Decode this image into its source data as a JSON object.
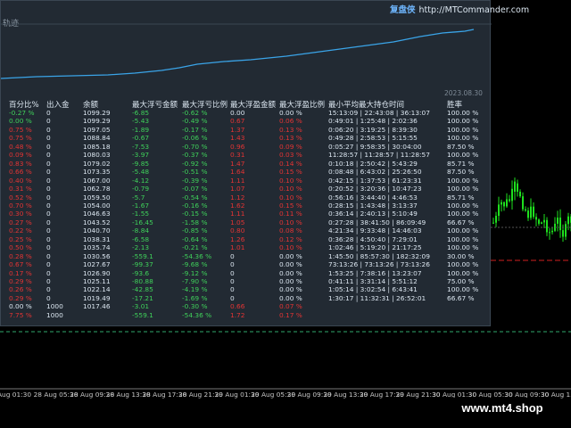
{
  "panel": {
    "title_cn": "复盘侠",
    "title_url": "http://MTCommander.com",
    "curve_label": "轨迹",
    "curve_date": "2023.08.30"
  },
  "colors": {
    "positive": "#3fd05a",
    "negative": "#e23434",
    "neutral": "#dbe6f0",
    "curve": "#3aa4e8"
  },
  "columns": [
    "百分比%",
    "出入金",
    "余额",
    "最大浮亏金额",
    "最大浮亏比例",
    "最大浮盈金额",
    "最大浮盈比例",
    "最小平均最大持仓时间",
    "胜率"
  ],
  "rows": [
    {
      "pct": "-0.27 %",
      "pc": "green",
      "io": "0",
      "bal": "1099.29",
      "fl": "-6.85",
      "flp": "-0.62 %",
      "fp": "0.00",
      "fpc": "white",
      "fpp": "0.00 %",
      "fppc": "white",
      "time": "15:13:09 | 22:43:08 | 36:13:07",
      "win": "100.00 %"
    },
    {
      "pct": "0.00 %",
      "pc": "green",
      "io": "0",
      "bal": "1099.29",
      "fl": "-5.43",
      "flp": "-0.49 %",
      "fp": "0.67",
      "fpc": "red",
      "fpp": "0.06 %",
      "fppc": "red",
      "time": "0:49:01 | 1:25:48 | 2:02:36",
      "win": "100.00 %"
    },
    {
      "pct": "0.75 %",
      "pc": "red",
      "io": "0",
      "bal": "1097.05",
      "fl": "-1.89",
      "flp": "-0.17 %",
      "fp": "1.37",
      "fpc": "red",
      "fpp": "0.13 %",
      "fppc": "red",
      "time": "0:06:20 | 3:19:25 | 8:39:30",
      "win": "100.00 %"
    },
    {
      "pct": "0.75 %",
      "pc": "red",
      "io": "0",
      "bal": "1088.84",
      "fl": "-0.67",
      "flp": "-0.06 %",
      "fp": "1.43",
      "fpc": "red",
      "fpp": "0.13 %",
      "fppc": "red",
      "time": "0:49:28 | 2:58:53 | 5:15:55",
      "win": "100.00 %"
    },
    {
      "pct": "0.48 %",
      "pc": "red",
      "io": "0",
      "bal": "1085.18",
      "fl": "-7.53",
      "flp": "-0.70 %",
      "fp": "0.96",
      "fpc": "red",
      "fpp": "0.09 %",
      "fppc": "red",
      "time": "0:05:27 | 9:58:35 | 30:04:00",
      "win": "87.50 %"
    },
    {
      "pct": "0.09 %",
      "pc": "red",
      "io": "0",
      "bal": "1080.03",
      "fl": "-3.97",
      "flp": "-0.37 %",
      "fp": "0.31",
      "fpc": "red",
      "fpp": "0.03 %",
      "fppc": "red",
      "time": "11:28:57 | 11:28:57 | 11:28:57",
      "win": "100.00 %"
    },
    {
      "pct": "0.83 %",
      "pc": "red",
      "io": "0",
      "bal": "1079.02",
      "fl": "-9.85",
      "flp": "-0.92 %",
      "fp": "1.47",
      "fpc": "red",
      "fpp": "0.14 %",
      "fppc": "red",
      "time": "0:10:18 | 2:50:42 | 5:43:29",
      "win": "85.71 %"
    },
    {
      "pct": "0.66 %",
      "pc": "red",
      "io": "0",
      "bal": "1073.35",
      "fl": "-5.48",
      "flp": "-0.51 %",
      "fp": "1.64",
      "fpc": "red",
      "fpp": "0.15 %",
      "fppc": "red",
      "time": "0:08:48 | 6:43:02 | 25:26:50",
      "win": "87.50 %"
    },
    {
      "pct": "0.40 %",
      "pc": "red",
      "io": "0",
      "bal": "1067.00",
      "fl": "-4.12",
      "flp": "-0.39 %",
      "fp": "1.11",
      "fpc": "red",
      "fpp": "0.10 %",
      "fppc": "red",
      "time": "0:42:15 | 1:37:53 | 61:23:31",
      "win": "100.00 %"
    },
    {
      "pct": "0.31 %",
      "pc": "red",
      "io": "0",
      "bal": "1062.78",
      "fl": "-0.79",
      "flp": "-0.07 %",
      "fp": "1.07",
      "fpc": "red",
      "fpp": "0.10 %",
      "fppc": "red",
      "time": "0:20:52 | 3:20:36 | 10:47:23",
      "win": "100.00 %"
    },
    {
      "pct": "0.52 %",
      "pc": "red",
      "io": "0",
      "bal": "1059.50",
      "fl": "-5.7",
      "flp": "-0.54 %",
      "fp": "1.12",
      "fpc": "red",
      "fpp": "0.10 %",
      "fppc": "red",
      "time": "0:56:16 | 3:44:40 | 4:46:53",
      "win": "85.71 %"
    },
    {
      "pct": "0.70 %",
      "pc": "red",
      "io": "0",
      "bal": "1054.00",
      "fl": "-1.67",
      "flp": "-0.16 %",
      "fp": "1.62",
      "fpc": "red",
      "fpp": "0.15 %",
      "fppc": "red",
      "time": "0:28:15 | 1:43:48 | 3:13:37",
      "win": "100.00 %"
    },
    {
      "pct": "0.30 %",
      "pc": "red",
      "io": "0",
      "bal": "1046.63",
      "fl": "-1.55",
      "flp": "-0.15 %",
      "fp": "1.11",
      "fpc": "red",
      "fpp": "0.11 %",
      "fppc": "red",
      "time": "0:36:14 | 2:40:13 | 5:10:49",
      "win": "100.00 %"
    },
    {
      "pct": "0.27 %",
      "pc": "red",
      "io": "0",
      "bal": "1043.52",
      "fl": "-16.45",
      "flp": "-1.58 %",
      "fp": "1.05",
      "fpc": "red",
      "fpp": "0.10 %",
      "fppc": "red",
      "time": "0:27:28 | 38:41:50 | 86:09:49",
      "win": "66.67 %"
    },
    {
      "pct": "0.22 %",
      "pc": "red",
      "io": "0",
      "bal": "1040.70",
      "fl": "-8.84",
      "flp": "-0.85 %",
      "fp": "0.80",
      "fpc": "red",
      "fpp": "0.08 %",
      "fppc": "red",
      "time": "4:21:34 | 9:33:48 | 14:46:03",
      "win": "100.00 %"
    },
    {
      "pct": "0.25 %",
      "pc": "red",
      "io": "0",
      "bal": "1038.31",
      "fl": "-6.58",
      "flp": "-0.64 %",
      "fp": "1.26",
      "fpc": "red",
      "fpp": "0.12 %",
      "fppc": "red",
      "time": "0:36:28 | 4:50:40 | 7:29:01",
      "win": "100.00 %"
    },
    {
      "pct": "0.50 %",
      "pc": "red",
      "io": "0",
      "bal": "1035.74",
      "fl": "-2.13",
      "flp": "-0.21 %",
      "fp": "1.01",
      "fpc": "red",
      "fpp": "0.10 %",
      "fppc": "red",
      "time": "1:02:46 | 5:19:20 | 21:17:25",
      "win": "100.00 %"
    },
    {
      "pct": "0.28 %",
      "pc": "red",
      "io": "0",
      "bal": "1030.56",
      "fl": "-559.1",
      "flp": "-54.36 %",
      "fp": "0",
      "fpc": "white",
      "fpp": "0.00 %",
      "fppc": "white",
      "time": "1:45:50 | 85:57:30 | 182:32:09",
      "win": "30.00 %"
    },
    {
      "pct": "0.67 %",
      "pc": "red",
      "io": "0",
      "bal": "1027.67",
      "fl": "-99.37",
      "flp": "-9.68 %",
      "fp": "0",
      "fpc": "white",
      "fpp": "0.00 %",
      "fppc": "white",
      "time": "73:13:26 | 73:13:26 | 73:13:26",
      "win": "100.00 %"
    },
    {
      "pct": "0.17 %",
      "pc": "red",
      "io": "0",
      "bal": "1026.90",
      "fl": "-93.6",
      "flp": "-9.12 %",
      "fp": "0",
      "fpc": "white",
      "fpp": "0.00 %",
      "fppc": "white",
      "time": "1:53:25 | 7:38:16 | 13:23:07",
      "win": "100.00 %"
    },
    {
      "pct": "0.29 %",
      "pc": "red",
      "io": "0",
      "bal": "1025.11",
      "fl": "-80.88",
      "flp": "-7.90 %",
      "fp": "0",
      "fpc": "white",
      "fpp": "0.00 %",
      "fppc": "white",
      "time": "0:41:11 | 3:31:14 | 5:51:12",
      "win": "75.00 %"
    },
    {
      "pct": "0.26 %",
      "pc": "red",
      "io": "0",
      "bal": "1022.14",
      "fl": "-42.85",
      "flp": "-4.19 %",
      "fp": "0",
      "fpc": "white",
      "fpp": "0.00 %",
      "fppc": "white",
      "time": "1:05:14 | 3:02:54 | 6:43:41",
      "win": "100.00 %"
    },
    {
      "pct": "0.29 %",
      "pc": "red",
      "io": "0",
      "bal": "1019.49",
      "fl": "-17.21",
      "flp": "-1.69 %",
      "fp": "0",
      "fpc": "white",
      "fpp": "0.00 %",
      "fppc": "white",
      "time": "1:30:17 | 11:32:31 | 26:52:01",
      "win": "66.67 %"
    },
    {
      "pct": "0.00 %",
      "pc": "white",
      "io": "1000",
      "bal": "1017.46",
      "fl": "-3.01",
      "flp": "-0.30 %",
      "fp": "0.66",
      "fpc": "red",
      "fpp": "0.07 %",
      "fppc": "red",
      "time": "",
      "win": ""
    },
    {
      "pct": "7.75 %",
      "pc": "red",
      "io": "1000",
      "bal": "",
      "fl": "-559.1",
      "flp": "-54.36 %",
      "fp": "1.72",
      "fpc": "red",
      "fpp": "0.17 %",
      "fppc": "red",
      "time": "",
      "win": ""
    }
  ],
  "axis": {
    "labels": [
      "Aug 01:30",
      "28 Aug 05:30",
      "28 Aug 09:30",
      "28 Aug 13:30",
      "28 Aug 17:30",
      "28 Aug 21:30",
      "29 Aug 01:30",
      "29 Aug 05:30",
      "29 Aug 09:30",
      "29 Aug 13:30",
      "29 Aug 17:30",
      "29 Aug 21:30",
      "30 Aug 01:30",
      "30 Aug 05:30",
      "30 Aug 09:30",
      "30 Aug 13:30"
    ]
  },
  "watermark": "www.mt4.shop"
}
